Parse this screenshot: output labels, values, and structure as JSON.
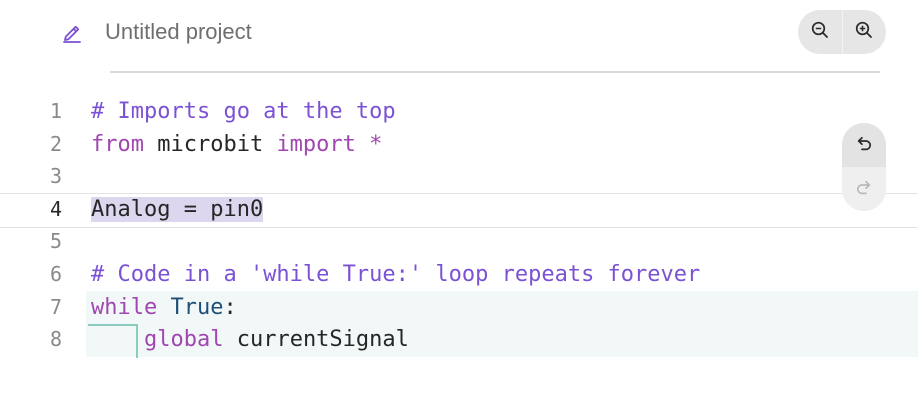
{
  "header": {
    "project_title": "Untitled project",
    "edit_icon": "pencil-icon",
    "zoom_out_icon": "zoom-out-icon",
    "zoom_in_icon": "zoom-in-icon"
  },
  "editor": {
    "active_line": 4,
    "lines": [
      {
        "number": "1",
        "tokens": [
          {
            "text": "# Imports go at the top",
            "kind": "comment"
          }
        ]
      },
      {
        "number": "2",
        "tokens": [
          {
            "text": "from",
            "kind": "keyword"
          },
          {
            "text": " microbit ",
            "kind": "plain"
          },
          {
            "text": "import",
            "kind": "keyword"
          },
          {
            "text": " *",
            "kind": "keyword"
          }
        ]
      },
      {
        "number": "3",
        "tokens": []
      },
      {
        "number": "4",
        "tokens": [
          {
            "text": "Analog = pin0",
            "kind": "plain"
          }
        ]
      },
      {
        "number": "5",
        "tokens": []
      },
      {
        "number": "6",
        "tokens": [
          {
            "text": "# Code in a 'while True:' loop repeats forever",
            "kind": "comment"
          }
        ]
      },
      {
        "number": "7",
        "tokens": [
          {
            "text": "while",
            "kind": "keyword"
          },
          {
            "text": " ",
            "kind": "plain"
          },
          {
            "text": "True",
            "kind": "builtin"
          },
          {
            "text": ":",
            "kind": "plain"
          }
        ]
      },
      {
        "number": "8",
        "tokens": [
          {
            "text": "    ",
            "kind": "plain"
          },
          {
            "text": "global",
            "kind": "keyword"
          },
          {
            "text": " currentSignal",
            "kind": "plain"
          }
        ]
      }
    ]
  },
  "history": {
    "undo_icon": "undo-icon",
    "redo_icon": "redo-icon"
  },
  "colors": {
    "comment": "#7b52d3",
    "keyword": "#a046b0",
    "builtin": "#1f4f77",
    "selection": "#dcd6ee",
    "block_background": "#f1f8f7",
    "indent_guide": "#8ccbc0"
  }
}
